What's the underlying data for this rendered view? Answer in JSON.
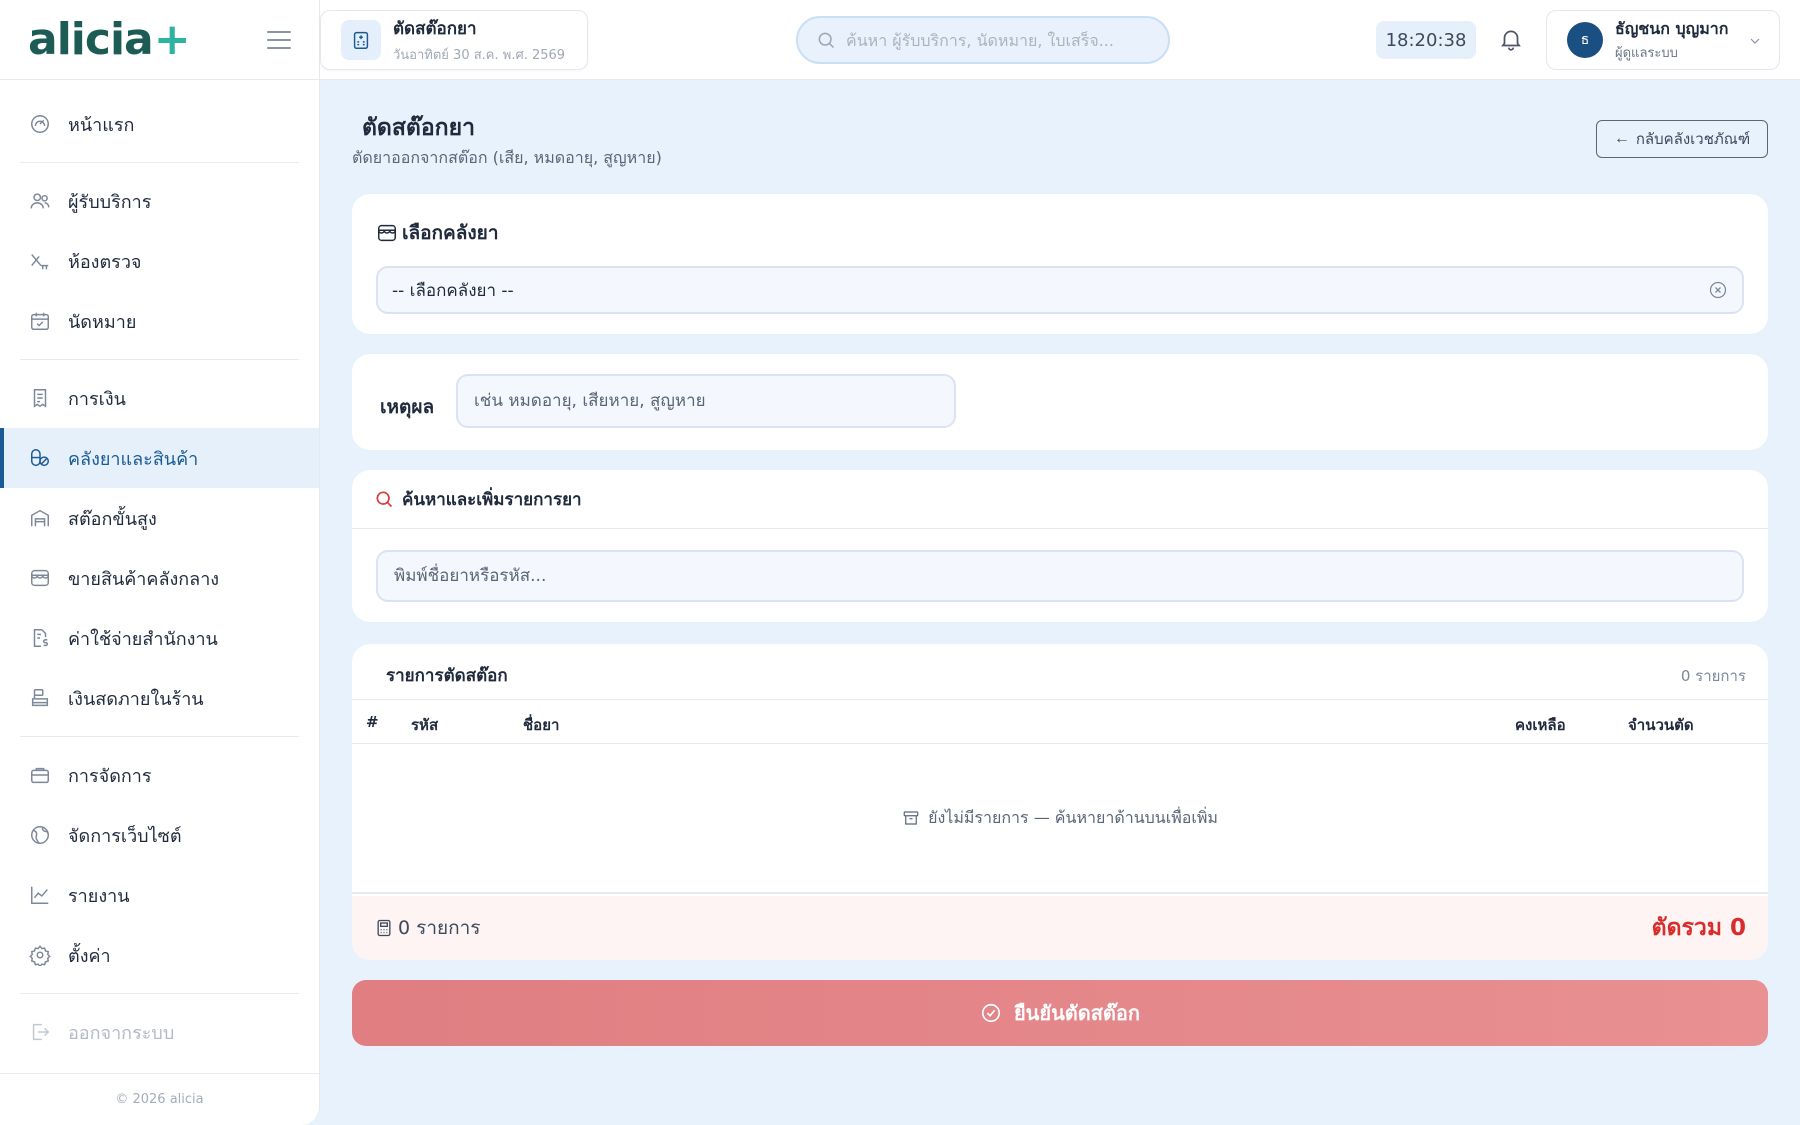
{
  "app": {
    "logo_text": "alicia",
    "logo_plus": "+"
  },
  "sidebar": {
    "items": [
      {
        "label": "หน้าแรก",
        "icon": "dashboard-icon"
      },
      {
        "label": "ผู้รับบริการ",
        "icon": "users-icon"
      },
      {
        "label": "ห้องตรวจ",
        "icon": "stethoscope-icon"
      },
      {
        "label": "นัดหมาย",
        "icon": "calendar-check-icon"
      },
      {
        "label": "การเงิน",
        "icon": "receipt-icon"
      },
      {
        "label": "คลังยาและสินค้า",
        "icon": "pills-icon",
        "active": true
      },
      {
        "label": "สต๊อกขั้นสูง",
        "icon": "warehouse-icon"
      },
      {
        "label": "ขายสินค้าคลังกลาง",
        "icon": "store-icon"
      },
      {
        "label": "ค่าใช้จ่ายสำนักงาน",
        "icon": "invoice-dollar-icon"
      },
      {
        "label": "เงินสดภายในร้าน",
        "icon": "cash-register-icon"
      },
      {
        "label": "การจัดการ",
        "icon": "briefcase-icon"
      },
      {
        "label": "จัดการเว็บไซต์",
        "icon": "globe-icon"
      },
      {
        "label": "รายงาน",
        "icon": "chart-line-icon"
      },
      {
        "label": "ตั้งค่า",
        "icon": "gear-icon"
      },
      {
        "label": "ออกจากระบบ",
        "icon": "logout-icon"
      }
    ],
    "copyright": "© 2026 alicia"
  },
  "topbar": {
    "page_title": "ตัดสต๊อกยา",
    "date": "วันอาทิตย์ 30 ส.ค. พ.ศ. 2569",
    "search_placeholder": "ค้นหา ผู้รับบริการ, นัดหมาย, ใบเสร็จ...",
    "time": "18:20:38",
    "user_initial": "ธ",
    "user_name": "ธัญชนก บุญมาก",
    "user_role": "ผู้ดูแลระบบ"
  },
  "main": {
    "title": "ตัดสต๊อกยา",
    "subtitle": "ตัดยาออกจากสต๊อก (เสีย, หมดอายุ, สูญหาย)",
    "back_label": "กลับคลังเวชภัณฑ์",
    "warehouse": {
      "heading": "เลือกคลังยา",
      "selected": "-- เลือกคลังยา --"
    },
    "reason": {
      "label": "เหตุผล",
      "placeholder": "เช่น หมดอายุ, เสียหาย, สูญหาย"
    },
    "drug_search": {
      "heading": "ค้นหาและเพิ่มรายการยา",
      "placeholder": "พิมพ์ชื่อยาหรือรหัส..."
    },
    "list": {
      "heading": "รายการตัดสต๊อก",
      "count": "0 รายการ",
      "columns": [
        "#",
        "รหัส",
        "ชื่อยา",
        "คงเหลือ",
        "จำนวนตัด"
      ],
      "empty_text": "ยังไม่มีรายการ — ค้นหายาด้านบนเพื่อเพิ่ม",
      "footer_count": "0 รายการ",
      "footer_total": "ตัดรวม 0"
    },
    "confirm_label": "ยืนยันตัดสต๊อก"
  },
  "colors": {
    "accent": "#1a5a95",
    "danger": "#d92d2d",
    "confirm": "#e4868a",
    "logo": "#1d5c55",
    "logo_plus": "#2db3a0"
  }
}
